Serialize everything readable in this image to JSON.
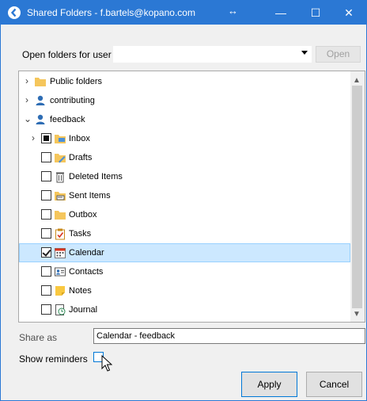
{
  "window": {
    "title": "Shared Folders - f.bartels@kopano.com"
  },
  "owner": {
    "label": "Open folders for user",
    "value": "",
    "open_label": "Open"
  },
  "tree": {
    "rows": [
      {
        "label": "Public folders",
        "icon": "folder-icon",
        "expander": ">",
        "check": "none"
      },
      {
        "label": "contributing",
        "icon": "user-icon",
        "expander": ">",
        "check": "none"
      },
      {
        "label": "feedback",
        "icon": "user-icon",
        "expander": "v",
        "check": "none"
      },
      {
        "label": "Inbox",
        "icon": "inbox-icon",
        "expander": ">",
        "check": "partial"
      },
      {
        "label": "Drafts",
        "icon": "drafts-icon",
        "expander": "",
        "check": "unchecked"
      },
      {
        "label": "Deleted Items",
        "icon": "trash-icon",
        "expander": "",
        "check": "unchecked"
      },
      {
        "label": "Sent Items",
        "icon": "sent-icon",
        "expander": "",
        "check": "unchecked"
      },
      {
        "label": "Outbox",
        "icon": "outbox-icon",
        "expander": "",
        "check": "unchecked"
      },
      {
        "label": "Tasks",
        "icon": "tasks-icon",
        "expander": "",
        "check": "unchecked"
      },
      {
        "label": "Calendar",
        "icon": "calendar-icon",
        "expander": "",
        "check": "checked",
        "selected": true
      },
      {
        "label": "Contacts",
        "icon": "contacts-icon",
        "expander": "",
        "check": "unchecked"
      },
      {
        "label": "Notes",
        "icon": "notes-icon",
        "expander": "",
        "check": "unchecked"
      },
      {
        "label": "Journal",
        "icon": "journal-icon",
        "expander": "",
        "check": "unchecked"
      }
    ]
  },
  "share_as": {
    "label": "Share as",
    "value": "Calendar - feedback"
  },
  "reminders": {
    "label": "Show reminders",
    "checked": false
  },
  "buttons": {
    "apply": "Apply",
    "cancel": "Cancel"
  },
  "colors": {
    "titlebar": "#2b78d4",
    "selection": "#cce8ff",
    "folder": "#f5c65c"
  }
}
